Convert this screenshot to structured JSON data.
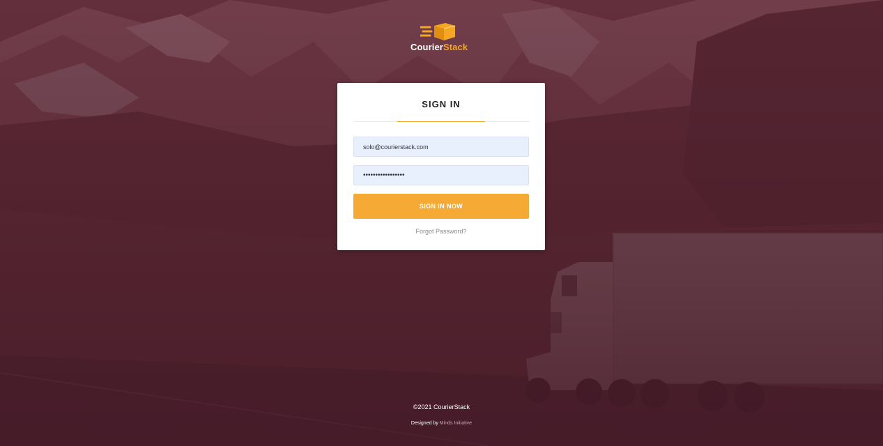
{
  "brand": {
    "name_part1": "Courier",
    "name_part2": "Stack",
    "accent_color": "#f5a623",
    "logo_icon": "delivery-box-icon"
  },
  "login": {
    "title": "SIGN IN",
    "email_value": "solo@courierstack.com",
    "password_value": "•••••••••••••••••",
    "submit_label": "SIGN IN NOW",
    "forgot_label": "Forgot Password?"
  },
  "footer": {
    "copyright": "©2021 CourierStack",
    "designed_by_prefix": "Designed by",
    "designed_by_link": "Minds Initiative"
  },
  "colors": {
    "overlay": "#5c2634",
    "button": "#f4aa35",
    "input_bg": "#e8f0fe"
  }
}
